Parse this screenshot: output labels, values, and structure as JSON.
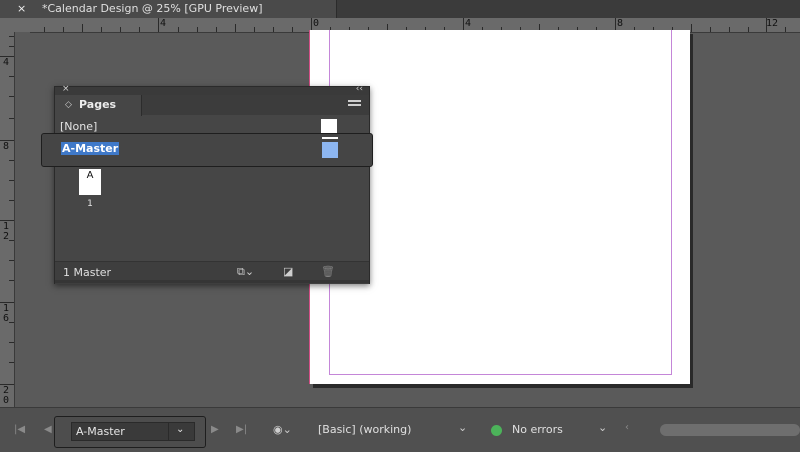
{
  "document_tab": {
    "close_glyph": "×",
    "title": "*Calendar Design @ 25% [GPU Preview]"
  },
  "ruler_top": {
    "labels": [
      "4",
      "0",
      "4",
      "8",
      "12"
    ]
  },
  "ruler_left": {
    "labels": [
      "4",
      "8",
      "1\n2",
      "1\n6",
      "2\n0"
    ]
  },
  "pages_panel": {
    "tab_label": "Pages",
    "none_row_label": "[None]",
    "master_row_label": "A-Master",
    "page_thumb_prefix": "A",
    "page_number": "1",
    "footer_count": "1 Master",
    "footer_icons": [
      "edit-page-size-icon",
      "new-page-icon",
      "trash-icon"
    ]
  },
  "status_bar": {
    "master_select_value": "A-Master",
    "preflight_profile": "[Basic] (working)",
    "preflight_status": "No errors",
    "status_color": "#4cb35a"
  },
  "colors": {
    "selection": "#3f79c9",
    "page_margin_guide": "#c486d8",
    "bleed_edge": "#d34f86"
  }
}
